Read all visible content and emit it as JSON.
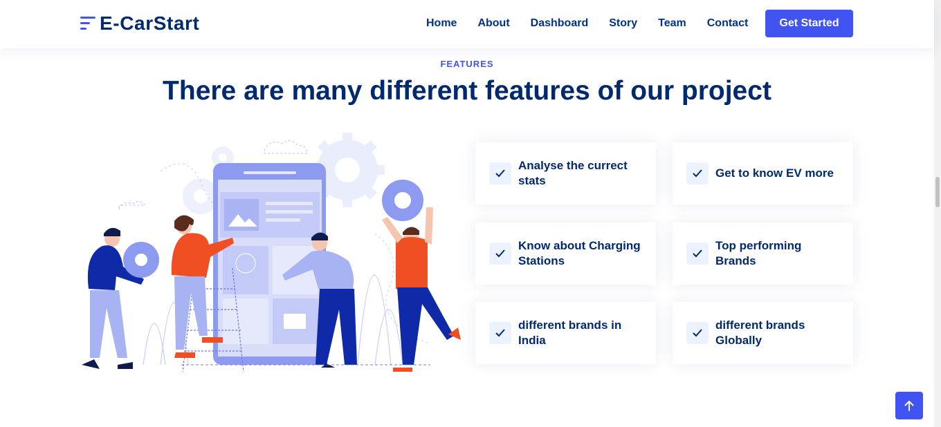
{
  "header": {
    "logo_text": "E-CarStart",
    "nav": [
      "Home",
      "About",
      "Dashboard",
      "Story",
      "Team",
      "Contact"
    ],
    "cta_label": "Get Started"
  },
  "features": {
    "label": "FEATURES",
    "title": "There are many different features of our project",
    "items": [
      "Analyse the currect stats",
      "Get to know EV more",
      "Know about Charging Stations",
      "Top performing Brands",
      "different brands in India",
      "different brands Globally"
    ]
  },
  "colors": {
    "accent": "#4154f1",
    "heading": "#012970",
    "check_bg": "#ecf3ff"
  },
  "icons": {
    "feature_check": "check-icon",
    "back_to_top": "arrow-up-icon"
  }
}
